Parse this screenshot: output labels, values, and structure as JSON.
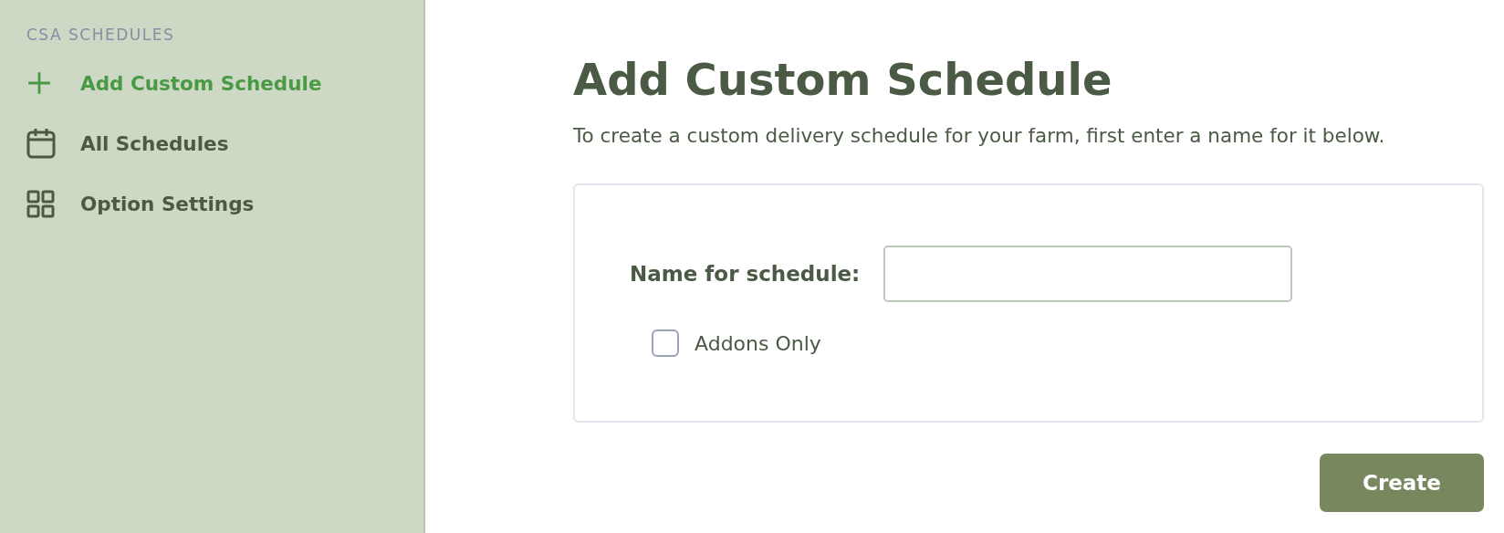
{
  "sidebar": {
    "heading": "CSA SCHEDULES",
    "items": [
      {
        "label": "Add Custom Schedule",
        "selected": true
      },
      {
        "label": "All Schedules",
        "selected": false
      },
      {
        "label": "Option Settings",
        "selected": false
      }
    ]
  },
  "main": {
    "title": "Add Custom Schedule",
    "description": "To create a custom delivery schedule for your farm, first enter a name for it below.",
    "form": {
      "name_label": "Name for schedule:",
      "checkbox": {
        "label": "Addons Only",
        "checked": false
      }
    },
    "submit": "Create"
  }
}
